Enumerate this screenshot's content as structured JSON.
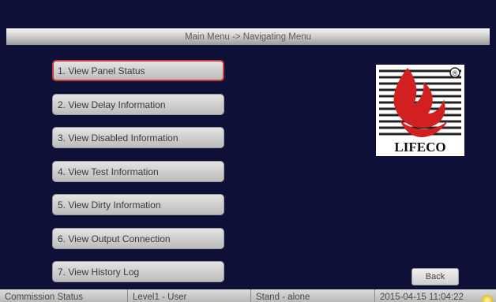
{
  "title_bar": {
    "breadcrumb": "Main Menu -> Navigating Menu"
  },
  "menu": {
    "items": [
      {
        "label": "1. View Panel Status",
        "selected": true
      },
      {
        "label": "2. View Delay Information"
      },
      {
        "label": "3. View Disabled Information"
      },
      {
        "label": "4. View Test Information"
      },
      {
        "label": "5. View Dirty Information"
      },
      {
        "label": "6. View Output Connection"
      },
      {
        "label": "7. View History Log"
      }
    ]
  },
  "logo": {
    "text": "LIFECO",
    "registered": "®"
  },
  "back_label": "Back",
  "status_bar": {
    "commission": "Commission Status",
    "level": "Level1 - User",
    "mode": "Stand - alone",
    "datetime": "2015-04-15 11:04:22"
  },
  "colors": {
    "background": "#0f1038",
    "accent_red": "#c73a3a"
  }
}
